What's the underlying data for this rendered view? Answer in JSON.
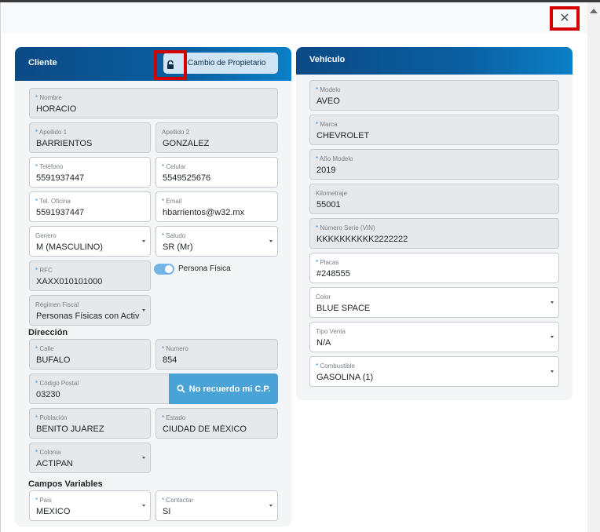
{
  "close_glyph": "✕",
  "cliente": {
    "title": "Cliente",
    "owner_button_label": "Cambio de Propietario",
    "fields": {
      "nombre": {
        "label": "Nombre",
        "value": "HORACIO"
      },
      "apellido1": {
        "label": "Apellido 1",
        "value": "BARRIENTOS"
      },
      "apellido2": {
        "label": "Apellido 2",
        "value": "GONZALEZ"
      },
      "telefono": {
        "label": "Teléfono",
        "value": "5591937447"
      },
      "celular": {
        "label": "Celular",
        "value": "5549525676"
      },
      "tel_oficina": {
        "label": "Tel. Oficina",
        "value": "5591937447"
      },
      "email": {
        "label": "Email",
        "value": "hbarrientos@w32.mx"
      },
      "genero": {
        "label": "Genero",
        "value": "M (MASCULINO)"
      },
      "saludo": {
        "label": "Saludo",
        "value": "SR (Mr)"
      },
      "rfc": {
        "label": "RFC",
        "value": "XAXX010101000"
      },
      "regimen": {
        "label": "Régimen Fiscal",
        "value": "Personas Físicas con Activ"
      }
    },
    "persona_fisica_label": "Persona Física",
    "direccion": {
      "title": "Dirección",
      "calle": {
        "label": "Calle",
        "value": "BUFALO"
      },
      "numero": {
        "label": "Numero",
        "value": "854"
      },
      "codigo_postal": {
        "label": "Código Postal",
        "value": "03230"
      },
      "cp_button_label": "No recuerdo mi C.P.",
      "poblacion": {
        "label": "Población",
        "value": "BENITO JUÁREZ"
      },
      "estado": {
        "label": "Estado",
        "value": "CIUDAD DE MÉXICO"
      },
      "colonia": {
        "label": "Colonia",
        "value": "ACTIPAN"
      }
    },
    "campos_variables": {
      "title": "Campos Variables",
      "pais": {
        "label": "Pais",
        "value": "MEXICO"
      },
      "contactar": {
        "label": "Contactar",
        "value": "SI"
      }
    }
  },
  "vehiculo": {
    "title": "Vehículo",
    "fields": {
      "modelo": {
        "label": "Modelo",
        "value": "AVEO"
      },
      "marca": {
        "label": "Marca",
        "value": "CHEVROLET"
      },
      "anio_modelo": {
        "label": "Año Modelo",
        "value": "2019"
      },
      "kilometraje": {
        "label": "Kilometraje",
        "value": "55001"
      },
      "vin": {
        "label": "Número Serie (VIN)",
        "value": "KKKKKKKKKK2222222"
      },
      "placas": {
        "label": "Placas",
        "value": "#248555"
      },
      "color": {
        "label": "Color",
        "value": "BLUE SPACE"
      },
      "tipo_venta": {
        "label": "Tipo Venta",
        "value": "N/A"
      },
      "combustible": {
        "label": "Combustible",
        "value": "GASOLINA (1)"
      }
    }
  }
}
